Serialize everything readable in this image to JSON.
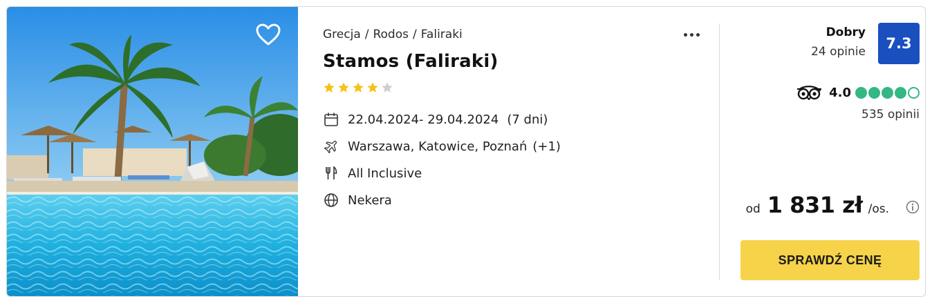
{
  "listing": {
    "breadcrumb": [
      "Grecja",
      "Rodos",
      "Faliraki"
    ],
    "breadcrumb_separator": "/",
    "title": "Stamos (Faliraki)",
    "stars": {
      "filled": 4,
      "total": 5
    },
    "dates": "22.04.2024- 29.04.2024",
    "duration": "(7 dni)",
    "departures": "Warszawa, Katowice, Poznań",
    "departures_more": "(+1)",
    "board": "All Inclusive",
    "operator": "Nekera"
  },
  "rating": {
    "label": "Dobry",
    "reviews": "24 opinie",
    "score": "7.3"
  },
  "tripadvisor": {
    "score": "4.0",
    "bubbles_filled": 4,
    "bubbles_total": 5,
    "reviews": "535 opinii"
  },
  "price": {
    "from": "od",
    "value": "1 831 zł",
    "unit": "/os."
  },
  "cta": {
    "label": "SPRAWDŹ CENĘ"
  },
  "icons": {
    "favorite": "heart-outline-icon",
    "more": "more-horizontal-icon",
    "dates": "calendar-icon",
    "departures": "plane-icon",
    "board": "cutlery-icon",
    "operator": "globe-icon",
    "tripadvisor": "tripadvisor-owl-icon",
    "info": "info-circle-icon"
  },
  "colors": {
    "score_badge": "#1a4fbf",
    "cta": "#f7d34a",
    "star": "#f5c21b",
    "star_empty": "#cfcfcf",
    "tripadvisor_bubble": "#34b783"
  }
}
